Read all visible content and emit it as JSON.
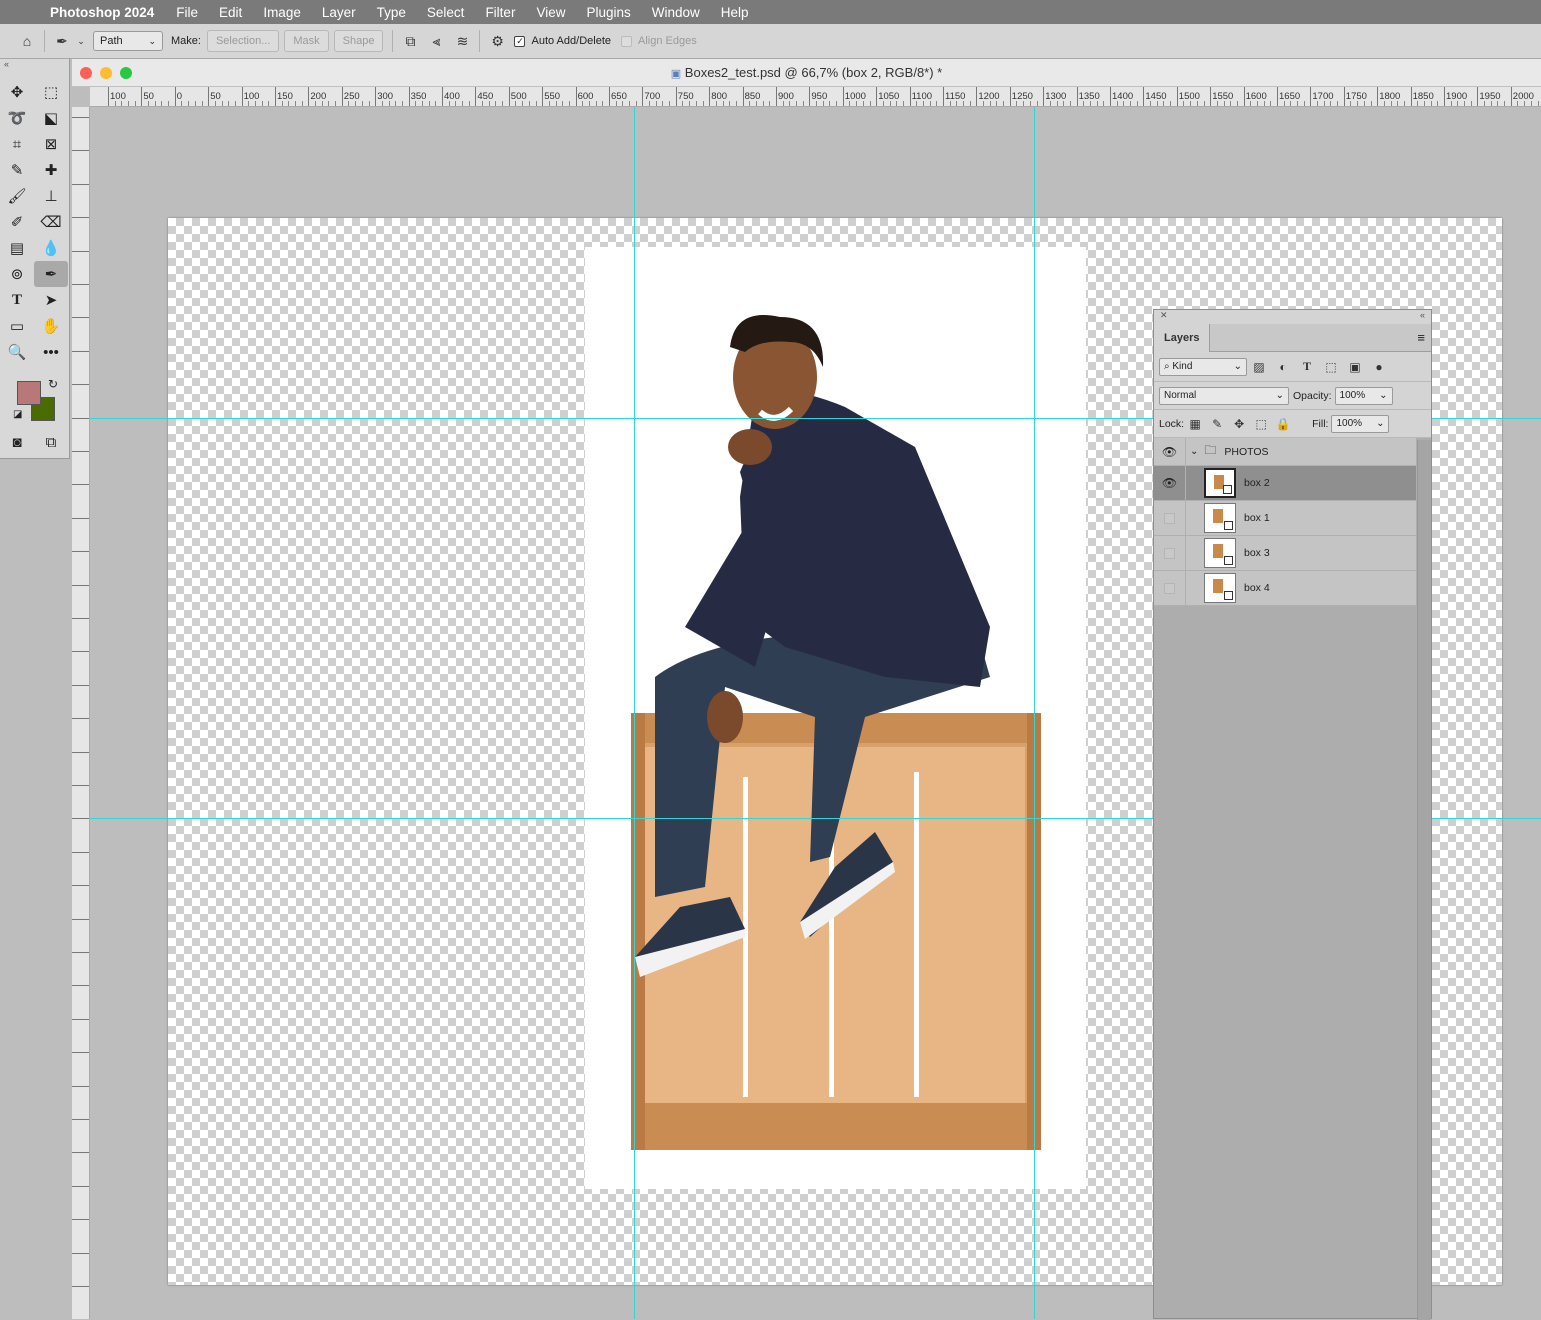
{
  "menubar": {
    "app_name": "Photoshop 2024",
    "items": [
      "File",
      "Edit",
      "Image",
      "Layer",
      "Type",
      "Select",
      "Filter",
      "View",
      "Plugins",
      "Window",
      "Help"
    ]
  },
  "options_bar": {
    "mode_value": "Path",
    "make_label": "Make:",
    "selection_label": "Selection...",
    "mask_label": "Mask",
    "shape_label": "Shape",
    "auto_add_delete_label": "Auto Add/Delete",
    "auto_add_delete_checked": true,
    "align_edges_label": "Align Edges"
  },
  "tools": {
    "foreground_color": "#b87878",
    "background_color": "#4a6b00",
    "active_tool": "pen-icon"
  },
  "document": {
    "title": "Boxes2_test.psd @ 66,7% (box 2, RGB/8*) *",
    "ruler_h_labels": [
      "100",
      "50",
      "0",
      "50",
      "100",
      "150",
      "200",
      "250",
      "300",
      "350",
      "400",
      "450",
      "500",
      "550",
      "600",
      "650",
      "700",
      "750",
      "800",
      "850",
      "900",
      "950",
      "1000",
      "1050",
      "1100",
      "1150",
      "1200",
      "1250",
      "1300",
      "1350",
      "1400",
      "1450",
      "1500",
      "1550",
      "1600",
      "1650",
      "1700",
      "1750",
      "1800",
      "1850",
      "1900",
      "1950",
      "2000"
    ]
  },
  "layers_panel": {
    "tab_label": "Layers",
    "filter_kind": "Kind",
    "blend_mode": "Normal",
    "opacity_label": "Opacity:",
    "opacity_value": "100%",
    "lock_label": "Lock:",
    "fill_label": "Fill:",
    "fill_value": "100%",
    "group_name": "PHOTOS",
    "layers": [
      {
        "name": "box 2",
        "visible": true,
        "selected": true
      },
      {
        "name": "box 1",
        "visible": false,
        "selected": false
      },
      {
        "name": "box 3",
        "visible": false,
        "selected": false
      },
      {
        "name": "box 4",
        "visible": false,
        "selected": false
      }
    ]
  }
}
